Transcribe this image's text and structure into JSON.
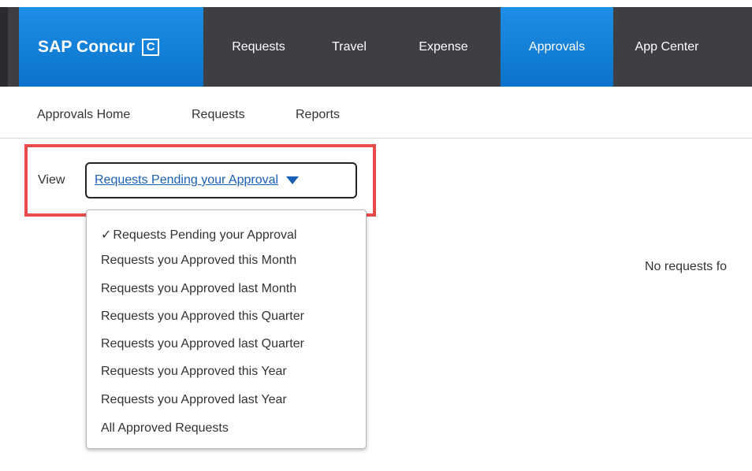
{
  "brand": {
    "name": "SAP Concur",
    "logo_letter": "C"
  },
  "nav": {
    "items": [
      {
        "label": "Requests"
      },
      {
        "label": "Travel"
      },
      {
        "label": "Expense"
      },
      {
        "label": "Approvals",
        "active": true
      },
      {
        "label": "App Center"
      }
    ]
  },
  "subnav": {
    "items": [
      {
        "label": "Approvals Home"
      },
      {
        "label": "Requests"
      },
      {
        "label": "Reports"
      }
    ]
  },
  "view": {
    "label": "View",
    "selected": "Requests Pending your Approval",
    "options": [
      "Requests Pending your Approval",
      "Requests you Approved this Month",
      "Requests you Approved last Month",
      "Requests you Approved this Quarter",
      "Requests you Approved last Quarter",
      "Requests you Approved this Year",
      "Requests you Approved last Year",
      "All Approved Requests"
    ],
    "check_glyph": "✓"
  },
  "main": {
    "empty_message": "No requests fo"
  },
  "colors": {
    "nav_background": "#3d3f44",
    "brand_blue": "#0f7dd6",
    "link_blue": "#1a5fb4",
    "highlight_red": "#e94b4b"
  }
}
